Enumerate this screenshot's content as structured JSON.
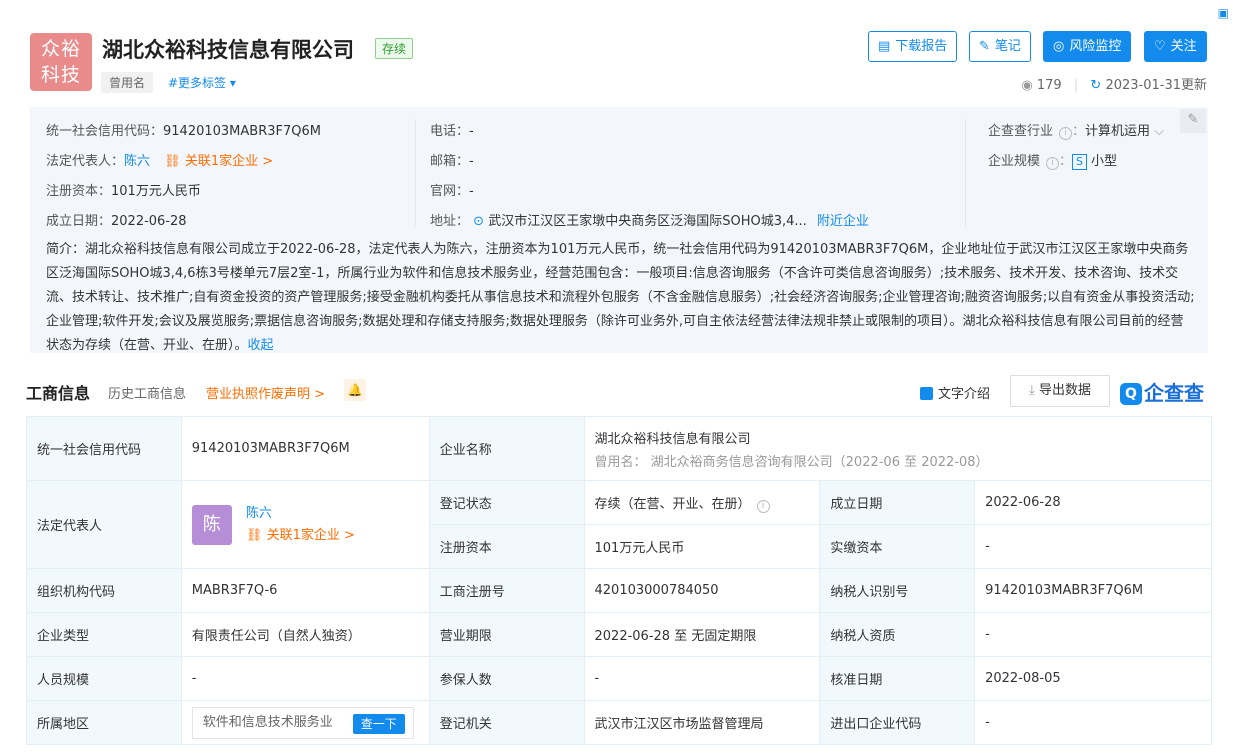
{
  "header": {
    "logo_text_line1": "众裕",
    "logo_text_line2": "科技",
    "company_name": "湖北众裕科技信息有限公司",
    "status": "存续",
    "former_name_tag": "曾用名",
    "more_tags": "#更多标签 ▾",
    "buttons": {
      "download": "下载报告",
      "notes": "笔记",
      "risk": "风险监控",
      "follow": "关注"
    },
    "view_count": "179",
    "update_date": "2023-01-31更新"
  },
  "basic_info": {
    "credit_code_label": "统一社会信用代码：",
    "credit_code": "91420103MABR3F7Q6M",
    "legal_rep_label": "法定代表人：",
    "legal_rep": "陈六",
    "related_link": "关联1家企业 >",
    "capital_label": "注册资本：",
    "capital": "101万元人民币",
    "founded_label": "成立日期：",
    "founded": "2022-06-28",
    "phone_label": "电话：",
    "phone": "-",
    "email_label": "邮箱：",
    "email": "-",
    "website_label": "官网：",
    "website": "-",
    "address_label": "地址：",
    "address": "武汉市江汉区王家墩中央商务区泛海国际SOHO城3,4...",
    "nearby_link": "附近企业",
    "industry_label": "企查查行业",
    "industry": "计算机运用",
    "scale_label": "企业规模",
    "scale_badge": "S",
    "scale": "小型",
    "intro": "简介：湖北众裕科技信息有限公司成立于2022-06-28，法定代表人为陈六，注册资本为101万元人民币，统一社会信用代码为91420103MABR3F7Q6M，企业地址位于武汉市江汉区王家墩中央商务区泛海国际SOHO城3,4,6栋3号楼单元7层2室-1，所属行业为软件和信息技术服务业，经营范围包含：一般项目:信息咨询服务（不含许可类信息咨询服务）;技术服务、技术开发、技术咨询、技术交流、技术转让、技术推广;自有资金投资的资产管理服务;接受金融机构委托从事信息技术和流程外包服务（不含金融信息服务）;社会经济咨询服务;企业管理咨询;融资咨询服务;以自有资金从事投资活动;企业管理;软件开发;会议及展览服务;票据信息咨询服务;数据处理和存储支持服务;数据处理服务（除许可业务外,可自主依法经营法律法规非禁止或限制的项目）。湖北众裕科技信息有限公司目前的经营状态为存续（在营、开业、在册）。",
    "collapse_link": "收起"
  },
  "section": {
    "title": "工商信息",
    "tab_history": "历史工商信息",
    "tab_license": "营业执照作废声明 >",
    "text_intro": "文字介绍",
    "export": "导出数据",
    "qcc_logo": "企查查"
  },
  "table": {
    "credit_code_label": "统一社会信用代码",
    "credit_code": "91420103MABR3F7Q6M",
    "company_name_label": "企业名称",
    "company_name": "湖北众裕科技信息有限公司",
    "former_name_line": "曾用名：  湖北众裕商务信息咨询有限公司（2022-06 至 2022-08）",
    "legal_rep_label": "法定代表人",
    "legal_rep_avatar": "陈",
    "legal_rep_name": "陈六",
    "legal_rep_related": "关联1家企业 >",
    "reg_status_label": "登记状态",
    "reg_status": "存续（在营、开业、在册）",
    "founded_label": "成立日期",
    "founded": "2022-06-28",
    "capital_label": "注册资本",
    "capital": "101万元人民币",
    "paid_capital_label": "实缴资本",
    "paid_capital": "-",
    "org_code_label": "组织机构代码",
    "org_code": "MABR3F7Q-6",
    "reg_no_label": "工商注册号",
    "reg_no": "420103000784050",
    "taxpayer_id_label": "纳税人识别号",
    "taxpayer_id": "91420103MABR3F7Q6M",
    "type_label": "企业类型",
    "type": "有限责任公司（自然人独资）",
    "term_label": "营业期限",
    "term": "2022-06-28 至 无固定期限",
    "taxpayer_qual_label": "纳税人资质",
    "taxpayer_qual": "-",
    "staff_label": "人员规模",
    "staff": "-",
    "insured_label": "参保人数",
    "insured": "-",
    "approval_label": "核准日期",
    "approval": "2022-08-05",
    "region_label": "所属地区",
    "region_search": "软件和信息技术服务业",
    "region_search_btn": "查一下",
    "authority_label": "登记机关",
    "authority": "武汉市江汉区市场监督管理局",
    "import_export_label": "进出口企业代码",
    "import_export": "-"
  }
}
